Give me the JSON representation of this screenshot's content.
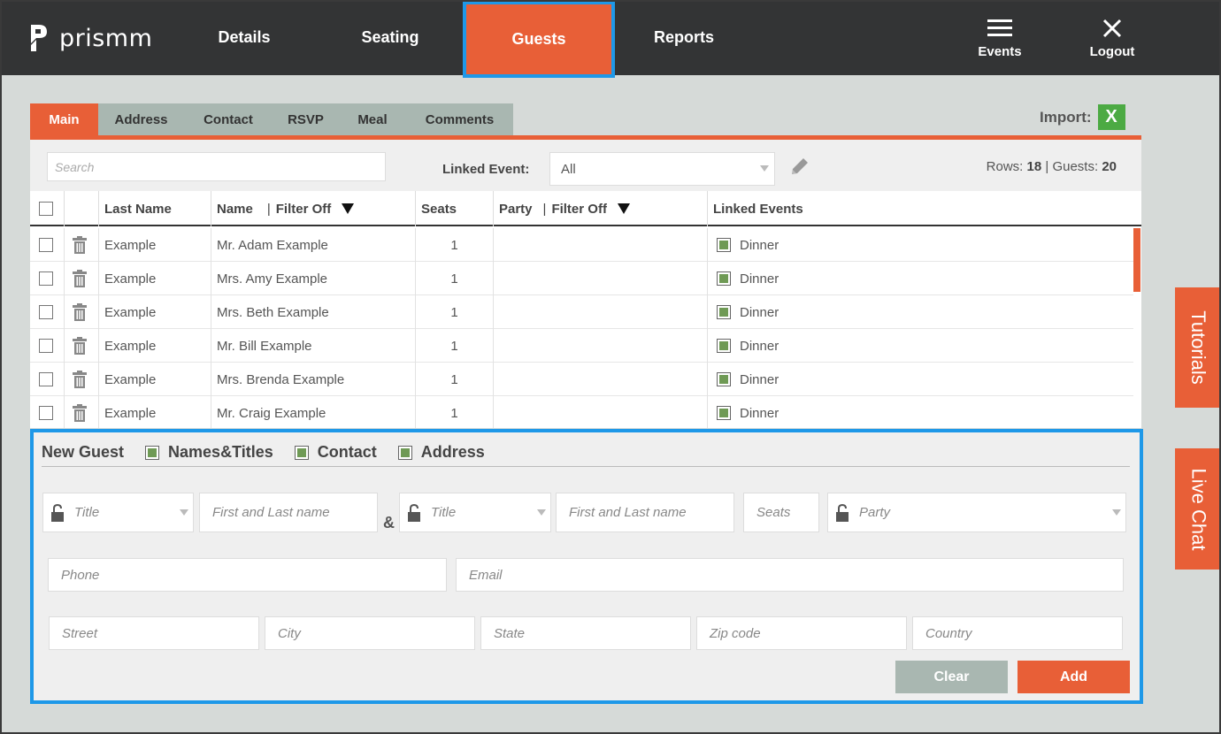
{
  "app": {
    "logo_text": "prismm"
  },
  "nav": {
    "items": [
      {
        "label": "Details"
      },
      {
        "label": "Seating"
      },
      {
        "label": "Guests"
      },
      {
        "label": "Reports"
      }
    ],
    "events_label": "Events",
    "logout_label": "Logout"
  },
  "subtabs": [
    {
      "label": "Main"
    },
    {
      "label": "Address"
    },
    {
      "label": "Contact"
    },
    {
      "label": "RSVP"
    },
    {
      "label": "Meal"
    },
    {
      "label": "Comments"
    }
  ],
  "import": {
    "label": "Import:",
    "icon": "X"
  },
  "toolbar": {
    "search_placeholder": "Search",
    "linked_event_label": "Linked Event:",
    "linked_event_value": "All",
    "rows_label": "Rows:",
    "rows_value": "18",
    "separator": "|",
    "guests_label": "Guests:",
    "guests_value": "20"
  },
  "table": {
    "headers": {
      "last_name": "Last Name",
      "name": "Name",
      "name_filter": "Filter Off",
      "seats": "Seats",
      "party": "Party",
      "party_filter": "Filter Off",
      "linked_events": "Linked Events"
    },
    "rows": [
      {
        "last": "Example",
        "name": "Mr. Adam Example",
        "seats": "1",
        "party": "",
        "event": "Dinner"
      },
      {
        "last": "Example",
        "name": "Mrs. Amy Example",
        "seats": "1",
        "party": "",
        "event": "Dinner"
      },
      {
        "last": "Example",
        "name": "Mrs. Beth Example",
        "seats": "1",
        "party": "",
        "event": "Dinner"
      },
      {
        "last": "Example",
        "name": "Mr. Bill Example",
        "seats": "1",
        "party": "",
        "event": "Dinner"
      },
      {
        "last": "Example",
        "name": "Mrs. Brenda Example",
        "seats": "1",
        "party": "",
        "event": "Dinner"
      },
      {
        "last": "Example",
        "name": "Mr. Craig Example",
        "seats": "1",
        "party": "",
        "event": "Dinner"
      }
    ]
  },
  "new_guest": {
    "title": "New Guest",
    "options": [
      "Names&Titles",
      "Contact",
      "Address"
    ],
    "fields": {
      "title1": "Title",
      "name1": "First and Last name",
      "amp": "&",
      "title2": "Title",
      "name2": "First and Last name",
      "seats": "Seats",
      "party": "Party",
      "phone": "Phone",
      "email": "Email",
      "street": "Street",
      "city": "City",
      "state": "State",
      "zip": "Zip code",
      "country": "Country"
    },
    "clear_label": "Clear",
    "add_label": "Add"
  },
  "side": {
    "tutorials": "Tutorials",
    "live_chat": "Live Chat"
  },
  "colors": {
    "accent": "#e85f37",
    "dark": "#333435",
    "tab_bg": "#a9b7b1",
    "focus": "#1e98e8",
    "excel": "#4caa43",
    "check": "#6f9a55"
  }
}
